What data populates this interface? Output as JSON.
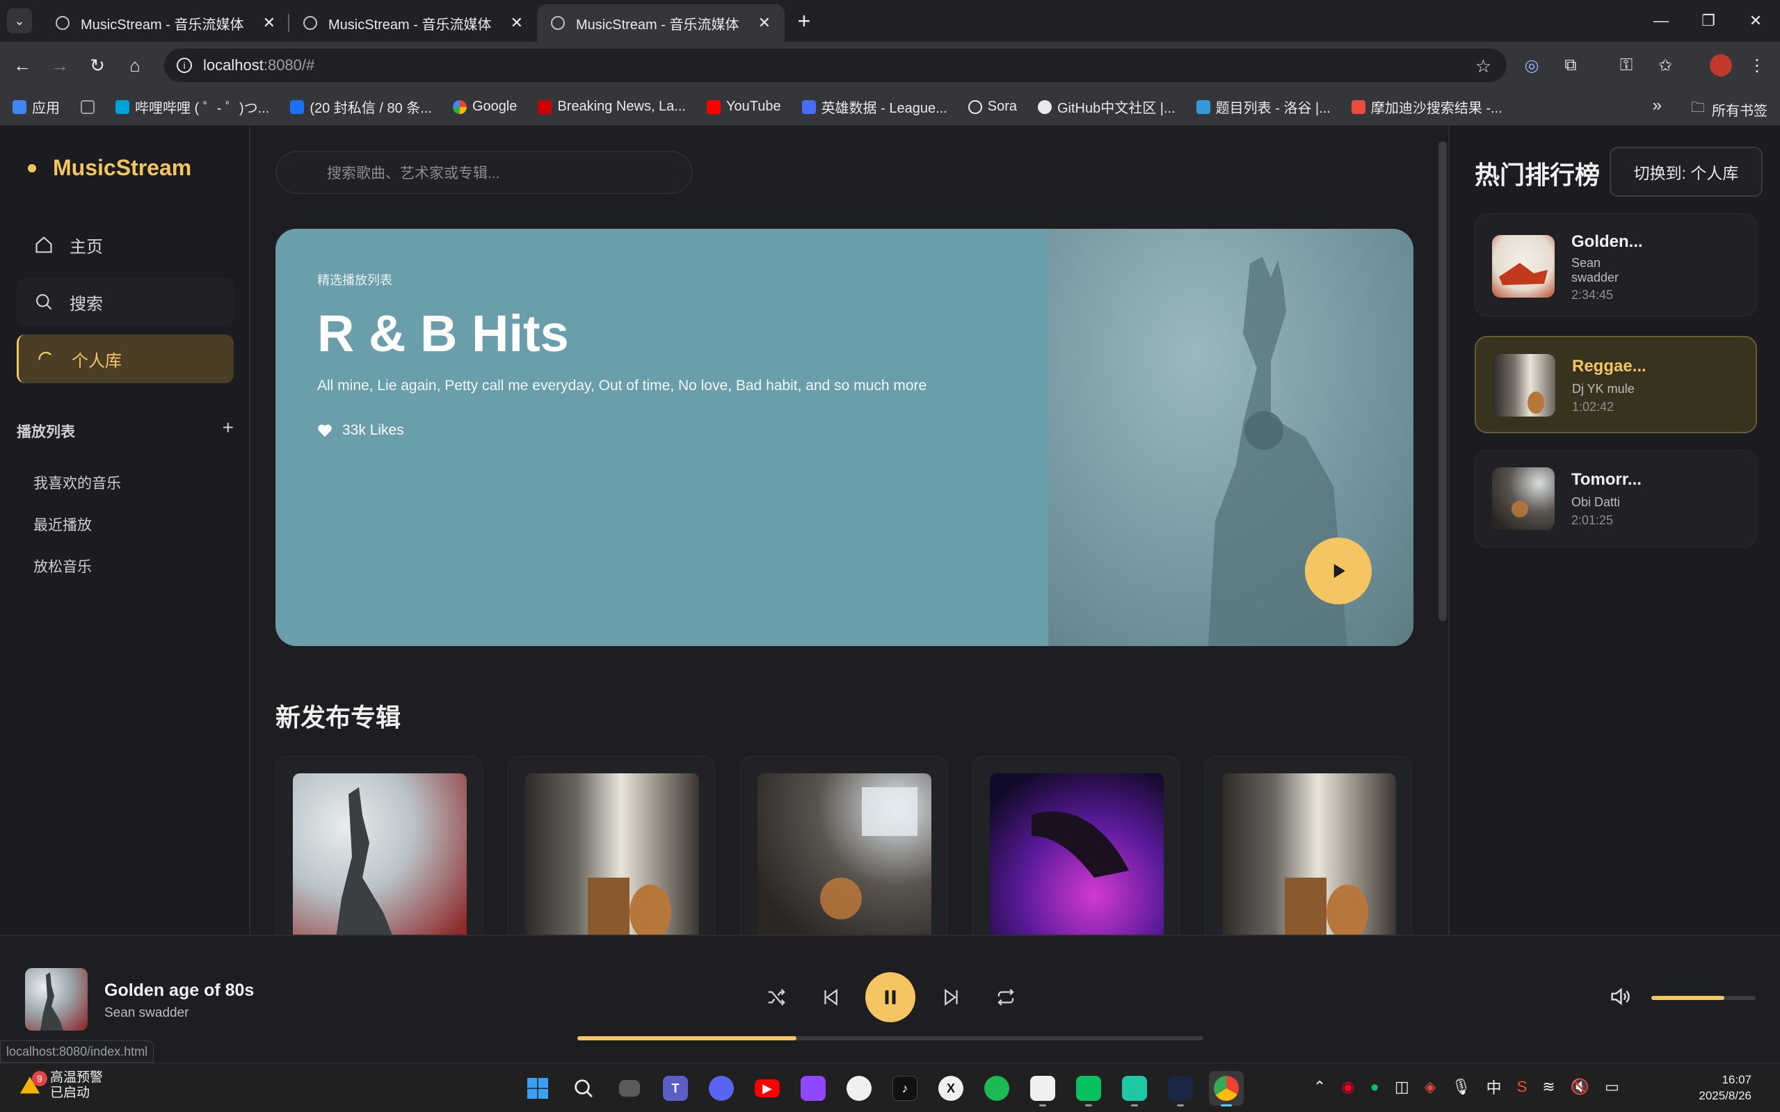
{
  "browser": {
    "tabs": [
      {
        "title": "MusicStream - 音乐流媒体"
      },
      {
        "title": "MusicStream - 音乐流媒体"
      },
      {
        "title": "MusicStream - 音乐流媒体"
      }
    ],
    "url_host": "localhost",
    "url_path": ":8080/#",
    "bookmarks": [
      {
        "label": "应用",
        "color": "#4285f4"
      },
      {
        "label": "",
        "color": "#9aa0a6"
      },
      {
        "label": "哔哩哔哩 ( ゜- ゜)つ...",
        "color": "#00a1d6"
      },
      {
        "label": "(20 封私信 / 80 条...",
        "color": "#1772f6"
      },
      {
        "label": "Google",
        "color": "#ea4335"
      },
      {
        "label": "Breaking News, La...",
        "color": "#cc0000"
      },
      {
        "label": "YouTube",
        "color": "#ff0000"
      },
      {
        "label": "英雄数据 - League...",
        "color": "#4a6cf7"
      },
      {
        "label": "Sora",
        "color": "#e8eaed"
      },
      {
        "label": "GitHub中文社区 |...",
        "color": "#e8eaed"
      },
      {
        "label": "题目列表 - 洛谷 |...",
        "color": "#3498db"
      },
      {
        "label": "摩加迪沙搜索结果 -...",
        "color": "#e74c3c"
      }
    ],
    "all_bookmarks": "所有书签",
    "status_url": "localhost:8080/index.html"
  },
  "app": {
    "logo": "MusicStream",
    "nav": {
      "home": "主页",
      "search": "搜索",
      "library": "个人库"
    },
    "playlists_header": "播放列表",
    "playlists": [
      "我喜欢的音乐",
      "最近播放",
      "放松音乐"
    ],
    "search_placeholder": "搜索歌曲、艺术家或专辑...",
    "hero": {
      "label": "精选播放列表",
      "title": "R & B Hits",
      "desc": "All mine, Lie again, Petty call me everyday, Out of time, No love, Bad habit, and so much more",
      "likes": "33k Likes"
    },
    "new_albums_title": "新发布专辑",
    "charts_title": "热门排行榜",
    "switch_label": "切换到: 个人库",
    "charts": [
      {
        "title": "Golden...",
        "artist": "Sean swadder",
        "duration": "2:34:45"
      },
      {
        "title": "Reggae...",
        "artist": "Dj YK mule",
        "duration": "1:02:42"
      },
      {
        "title": "Tomorr...",
        "artist": "Obi Datti",
        "duration": "2:01:25"
      }
    ]
  },
  "player": {
    "title": "Golden age of 80s",
    "artist": "Sean swadder",
    "progress": 0.35,
    "volume": 0.7
  },
  "taskbar": {
    "weather_badge": "9",
    "weather_title": "高温预警",
    "weather_sub": "已启动",
    "ime": "中",
    "time": "16:07",
    "date": "2025/8/26"
  }
}
